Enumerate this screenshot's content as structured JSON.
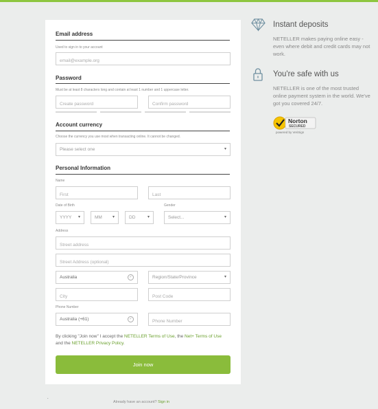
{
  "form": {
    "email": {
      "title": "Email address",
      "hint": "Used to sign in to your account",
      "placeholder": "email@example.org"
    },
    "password": {
      "title": "Password",
      "hint": "Must be at least 8 characters long and contain at least 1 number and 1 uppercase letter.",
      "create_placeholder": "Create password",
      "confirm_placeholder": "Confirm password"
    },
    "currency": {
      "title": "Account currency",
      "hint": "Choose the currency you use most when transacting online. It cannot be changed.",
      "placeholder": "Please select one"
    },
    "personal": {
      "title": "Personal Information",
      "name_label": "Name",
      "first_placeholder": "First",
      "last_placeholder": "Last",
      "dob_label": "Date of Birth",
      "yyyy": "YYYY",
      "mm": "MM",
      "dd": "DD",
      "gender_label": "Gender",
      "gender_placeholder": "Select...",
      "address_label": "Address",
      "street_placeholder": "Street address",
      "street2_placeholder": "Street Address (optional)",
      "country_value": "Australia",
      "region_placeholder": "Region/State/Province",
      "city_placeholder": "City",
      "postcode_placeholder": "Post Code",
      "phone_label": "Phone Number",
      "phone_country_value": "Australia (+61)",
      "phone_placeholder": "Phone Number"
    },
    "terms": {
      "prefix": "By clicking \"Join now\" I accept the ",
      "link1": "NETELLER Terms of Use",
      "mid": ", the ",
      "link2": "Net+ Terms of Use",
      "and": "and the ",
      "link3": "NETELLER Privacy Policy",
      "suffix": "."
    },
    "join_label": "Join now"
  },
  "footer": {
    "prompt": "Already have an account?",
    "signin_link": "Sign in",
    "dot": "."
  },
  "sidebar": {
    "deposits": {
      "icon": "diamond-icon",
      "title": "Instant deposits",
      "text": "NETELLER makes paying online easy - even where debit and credit cards may not work."
    },
    "safe": {
      "icon": "lock-icon",
      "title": "You're safe with us",
      "text": "NETELLER is one of the most trusted online payment system in the world. We've got you covered 24/7."
    },
    "badge": {
      "name": "Norton",
      "status": "SECURED",
      "powered": "powered by VeriSign"
    }
  },
  "colors": {
    "accent": "#8dc63f",
    "button": "#8abc3b",
    "link": "#6aa02d",
    "background": "#ebedec"
  }
}
